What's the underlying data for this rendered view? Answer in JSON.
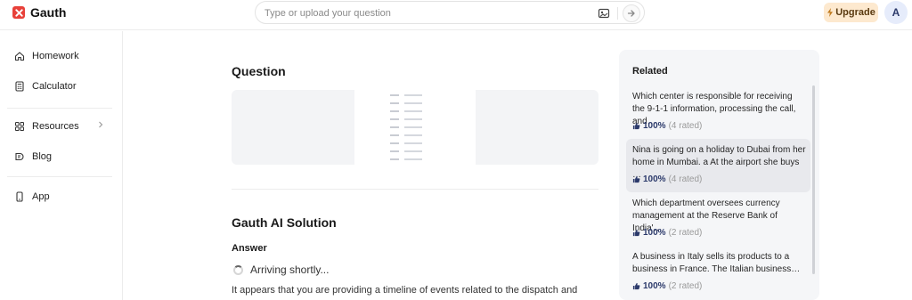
{
  "header": {
    "logo_text": "Gauth",
    "search_placeholder": "Type or upload your question",
    "upgrade_label": "Upgrade",
    "avatar_initial": "A"
  },
  "sidebar": {
    "items": [
      {
        "label": "Homework",
        "icon": "home-icon"
      },
      {
        "label": "Calculator",
        "icon": "calculator-icon"
      },
      {
        "label": "Resources",
        "icon": "grid-icon"
      },
      {
        "label": "Blog",
        "icon": "blog-icon"
      },
      {
        "label": "App",
        "icon": "phone-icon"
      }
    ]
  },
  "main": {
    "question_heading": "Question",
    "solution_heading": "Gauth AI Solution",
    "answer_heading": "Answer",
    "arriving_text": "Arriving shortly...",
    "answer_text": "It appears that you are providing a timeline of events related to the dispatch and"
  },
  "related": {
    "title": "Related",
    "items": [
      {
        "question": "Which center is responsible for receiving the 9-1-1 information, processing the call, and…",
        "percent": "100%",
        "rated": "(4 rated)"
      },
      {
        "question": "Nina is going on a holiday to Dubai from her home in Mumbai. a At the airport she buys …",
        "percent": "100%",
        "rated": "(4 rated)"
      },
      {
        "question": "Which department oversees currency management at the Reserve Bank of India'…",
        "percent": "100%",
        "rated": "(2 rated)"
      },
      {
        "question": "A business in Italy sells its products to a business in France. The Italian business…",
        "percent": "100%",
        "rated": "(2 rated)"
      }
    ]
  },
  "colors": {
    "brand": "#e8413a",
    "upgrade_bg": "#fde9cf",
    "rating": "#2c3a6b"
  }
}
